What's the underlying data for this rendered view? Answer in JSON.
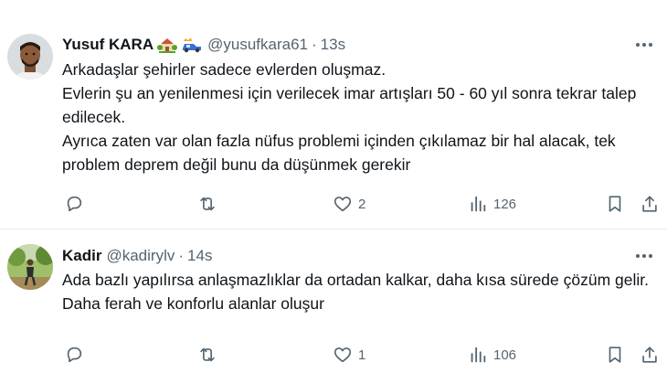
{
  "tweets": [
    {
      "name": "Yusuf KARA",
      "handle": "@yusufkara61",
      "time": "13s",
      "lines": [
        "Arkadaşlar şehirler sadece evlerden oluşmaz.",
        "Evlerin şu an yenilenmesi için verilecek imar artışları 50 - 60 yıl sonra tekrar talep edilecek.",
        "Ayrıca zaten var olan fazla nüfus problemi içinden çıkılamaz bir hal alacak, tek problem deprem değil bunu da düşünmek gerekir"
      ],
      "replies": "",
      "retweets": "",
      "likes": "2",
      "views": "126",
      "emojis": [
        "house-with-garden-icon",
        "car-crash-icon"
      ]
    },
    {
      "name": "Kadir",
      "handle": "@kadirylv",
      "time": "14s",
      "lines": [
        "Ada bazlı yapılırsa anlaşmazlıklar da ortadan kalkar, daha kısa sürede çözüm gelir. Daha ferah ve konforlu alanlar oluşur"
      ],
      "replies": "",
      "retweets": "",
      "likes": "1",
      "views": "106"
    }
  ],
  "separator": "·",
  "colors": {
    "text": "#0f1419",
    "secondary": "#536471",
    "divider": "#e6ecf0"
  }
}
